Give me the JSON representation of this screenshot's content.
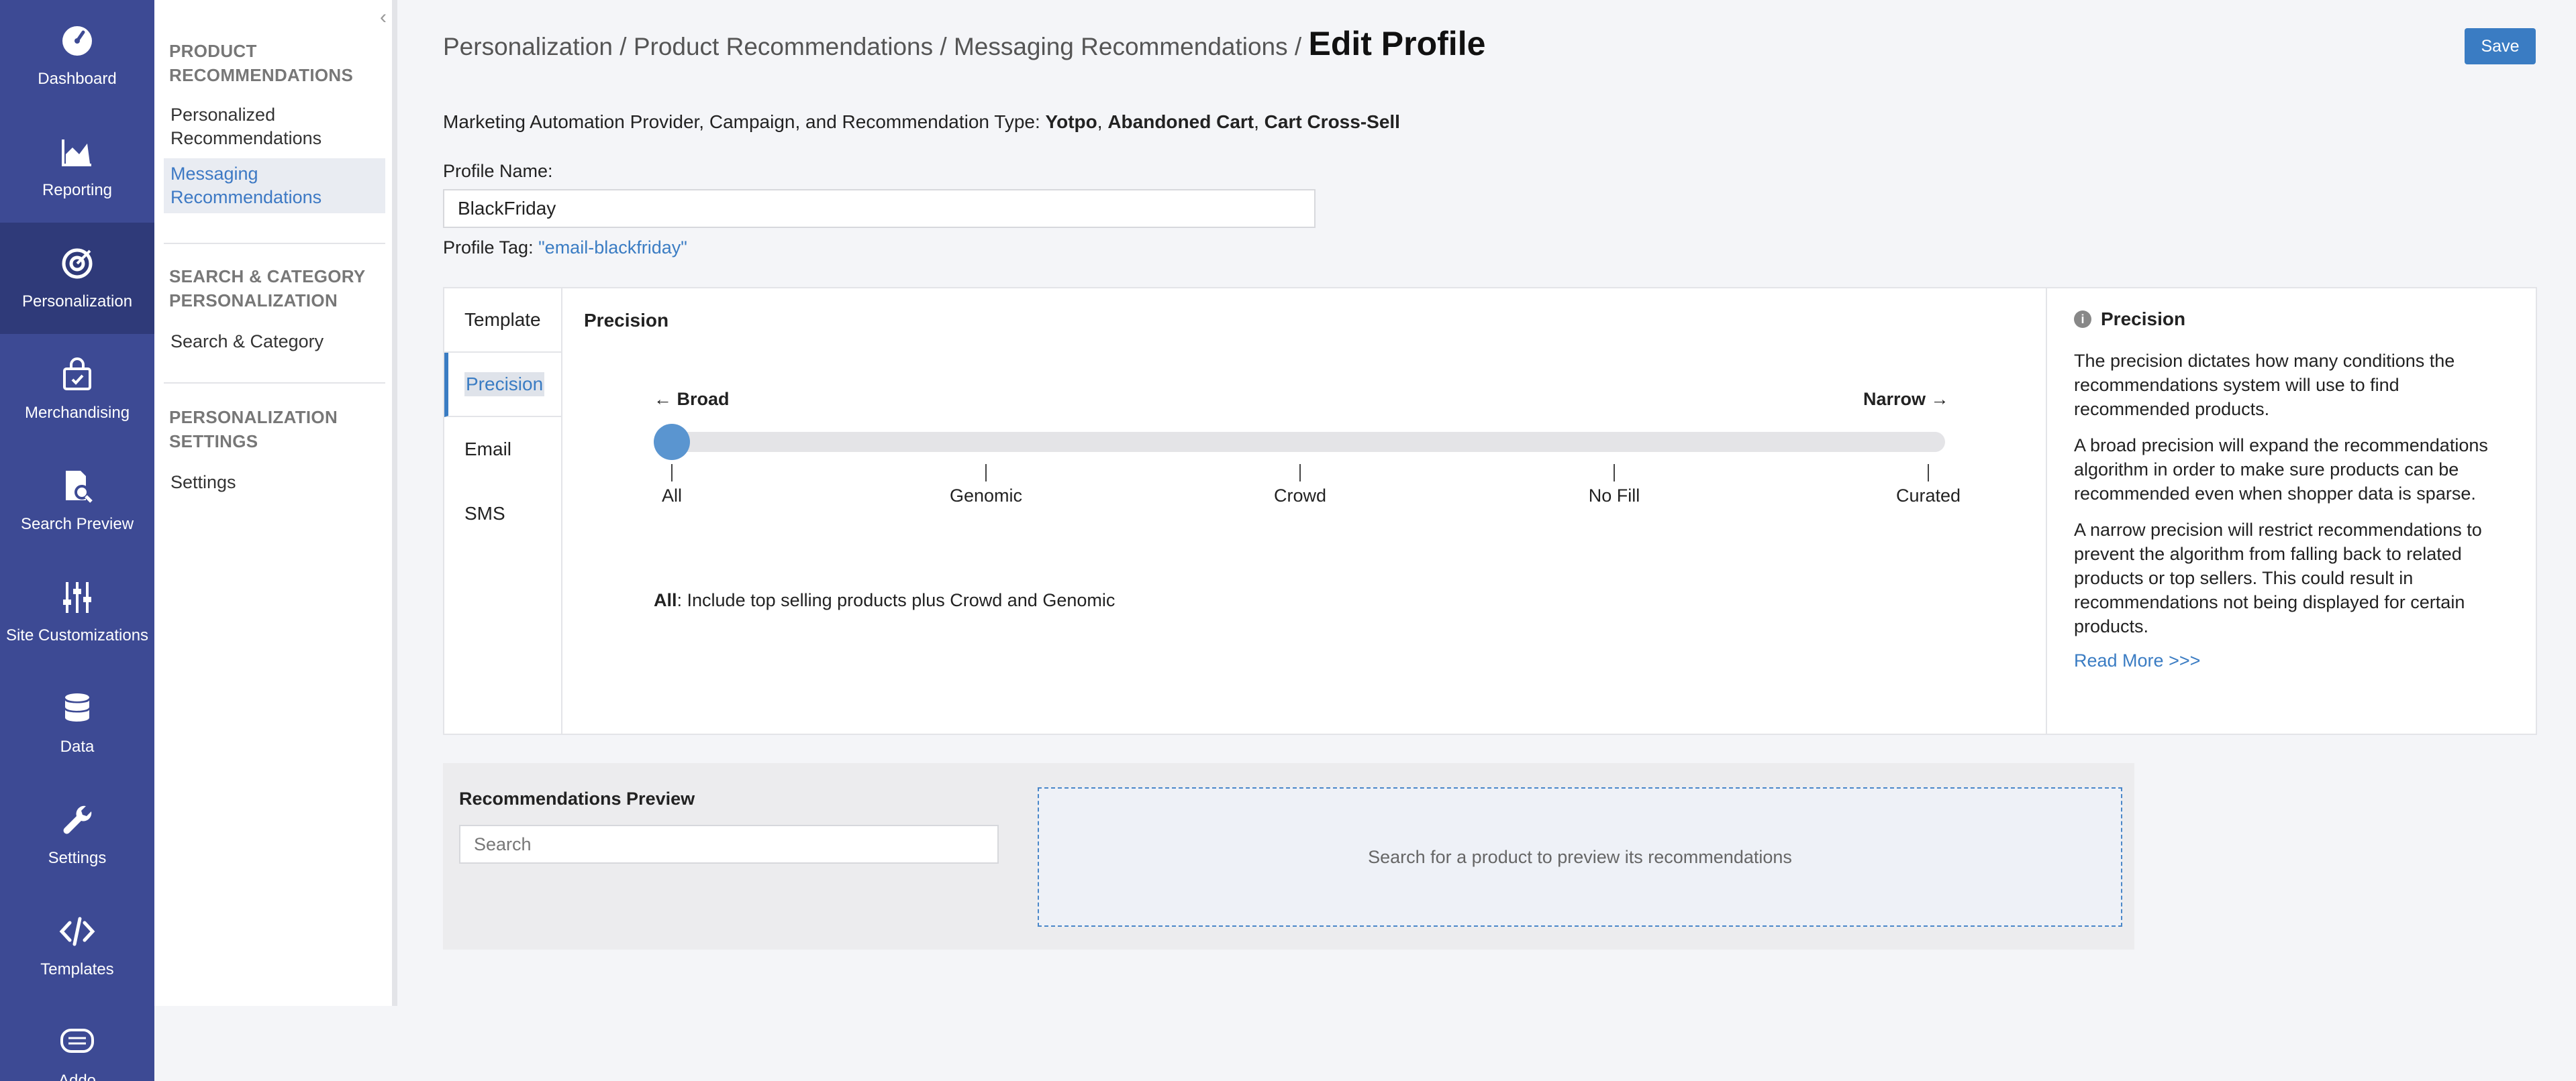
{
  "nav": {
    "items": [
      {
        "label": "Dashboard",
        "icon": "gauge-icon"
      },
      {
        "label": "Reporting",
        "icon": "chart-icon"
      },
      {
        "label": "Personalization",
        "icon": "target-icon"
      },
      {
        "label": "Merchandising",
        "icon": "bag-icon"
      },
      {
        "label": "Search Preview",
        "icon": "search-doc-icon"
      },
      {
        "label": "Site Customizations",
        "icon": "sliders-icon"
      },
      {
        "label": "Data",
        "icon": "database-icon"
      },
      {
        "label": "Settings",
        "icon": "wrench-icon"
      },
      {
        "label": "Templates",
        "icon": "code-icon"
      },
      {
        "label": "Addo",
        "icon": "chat-icon"
      }
    ],
    "active": "Personalization"
  },
  "subnav": {
    "collapse_glyph": "‹",
    "sections": [
      {
        "heading": "PRODUCT RECOMMENDATIONS",
        "links": [
          "Personalized Recommendations",
          "Messaging Recommendations"
        ]
      },
      {
        "heading": "SEARCH & CATEGORY PERSONALIZATION",
        "links": [
          "Search & Category"
        ]
      },
      {
        "heading": "PERSONALIZATION SETTINGS",
        "links": [
          "Settings"
        ]
      }
    ],
    "active_link": "Messaging Recommendations"
  },
  "header": {
    "breadcrumb_path": "Personalization / Product Recommendations / Messaging Recommendations / ",
    "current": "Edit Profile",
    "save_label": "Save"
  },
  "provider": {
    "label": "Marketing Automation Provider, Campaign, and Recommendation Type: ",
    "provider": "Yotpo",
    "sep1": ", ",
    "campaign": "Abandoned Cart",
    "sep2": ", ",
    "type": "Cart Cross-Sell"
  },
  "profile": {
    "name_label": "Profile Name:",
    "name_value": "BlackFriday",
    "tag_label": "Profile Tag: ",
    "tag_value": "\"email-blackfriday\""
  },
  "tabs": {
    "items": [
      "Template",
      "Precision",
      "Email",
      "SMS"
    ],
    "active": "Precision"
  },
  "precision": {
    "title": "Precision",
    "broad_label": "← Broad",
    "narrow_label": "Narrow →",
    "levels": [
      "All",
      "Genomic",
      "Crowd",
      "No Fill",
      "Curated"
    ],
    "selected_index": 0,
    "selected_name": "All",
    "selected_desc": ": Include top selling products plus Crowd and Genomic"
  },
  "help": {
    "title": "Precision",
    "paragraphs": [
      "The precision dictates how many conditions the recommendations system will use to find recommended products.",
      "A broad precision will expand the recommendations algorithm in order to make sure products can be recommended even when shopper data is sparse.",
      "A narrow precision will restrict recommendations to prevent the algorithm from falling back to related products or top sellers. This could result in recommendations not being displayed for certain products."
    ],
    "read_more": "Read More >>>"
  },
  "preview": {
    "title": "Recommendations Preview",
    "search_placeholder": "Search",
    "empty_text": "Search for a product to preview its recommendations"
  },
  "colors": {
    "nav_bg": "#3d4a94",
    "nav_active": "#2f3a79",
    "accent": "#3a7cc3",
    "slider_thumb": "#5a95d0"
  }
}
